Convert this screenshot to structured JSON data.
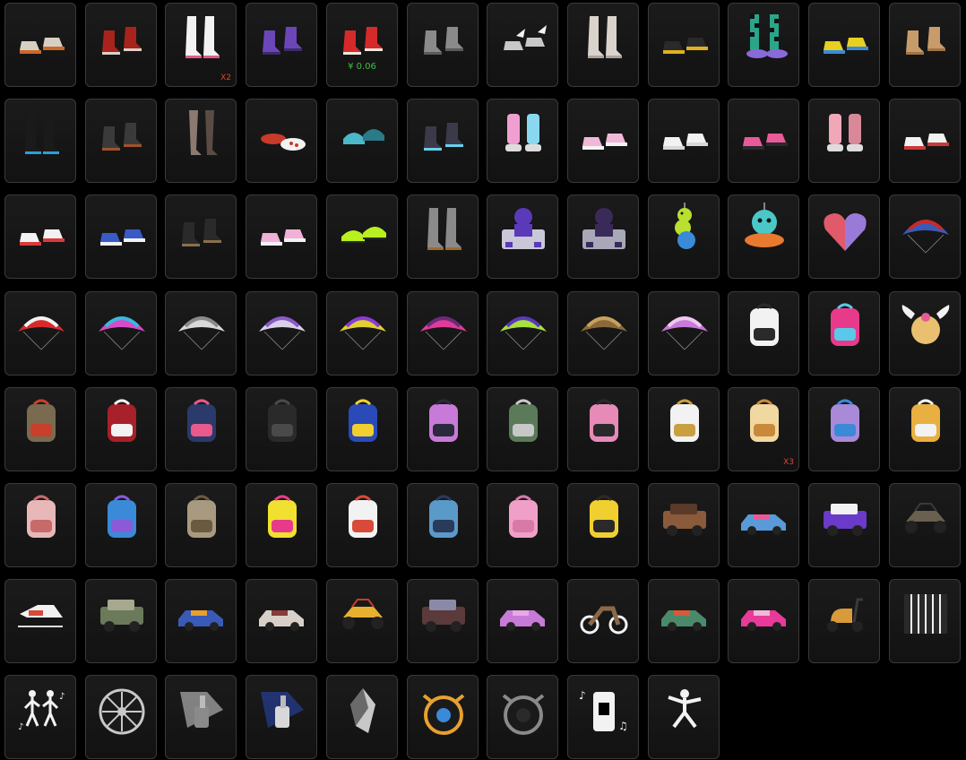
{
  "items": [
    {
      "name": "shoes",
      "icon": "sneakers-icon",
      "colors": [
        "#d8cfc4",
        "#c96a2a"
      ],
      "count": "",
      "price": ""
    },
    {
      "name": "shoes",
      "icon": "boots-icon",
      "colors": [
        "#a8231c",
        "#d9d0c8"
      ],
      "count": "",
      "price": ""
    },
    {
      "name": "shoes",
      "icon": "tall-boots-icon",
      "colors": [
        "#f2f2f2",
        "#e05a8a"
      ],
      "count": "X2",
      "price": ""
    },
    {
      "name": "shoes",
      "icon": "boots-icon",
      "colors": [
        "#6b46b8",
        "#3c2a6a"
      ],
      "count": "",
      "price": ""
    },
    {
      "name": "shoes",
      "icon": "boots-icon",
      "colors": [
        "#d42a2a",
        "#f0e6e0"
      ],
      "count": "",
      "price": "¥ 0.06"
    },
    {
      "name": "shoes",
      "icon": "boots-icon",
      "colors": [
        "#8a8a8a",
        "#5a5a5a"
      ],
      "count": "",
      "price": ""
    },
    {
      "name": "shoes",
      "icon": "winged-shoes-icon",
      "colors": [
        "#c8c8c8",
        "#f2f2f2"
      ],
      "count": "",
      "price": ""
    },
    {
      "name": "shoes",
      "icon": "tall-boots-icon",
      "colors": [
        "#d9d3cc",
        "#a9a39c"
      ],
      "count": "",
      "price": ""
    },
    {
      "name": "shoes",
      "icon": "sneakers-icon",
      "colors": [
        "#2a2a2a",
        "#e0b020"
      ],
      "count": "",
      "price": ""
    },
    {
      "name": "shoes",
      "icon": "checker-socks-icon",
      "colors": [
        "#2aa58a",
        "#8a6ad8"
      ],
      "count": "",
      "price": ""
    },
    {
      "name": "shoes",
      "icon": "sneakers-icon",
      "colors": [
        "#e8d020",
        "#3a8ad8"
      ],
      "count": "",
      "price": ""
    },
    {
      "name": "shoes",
      "icon": "boots-icon",
      "colors": [
        "#c79b6a",
        "#a07445"
      ],
      "count": "",
      "price": ""
    },
    {
      "name": "shoes",
      "icon": "tall-boots-icon",
      "colors": [
        "#1a1a1a",
        "#2aa0d8"
      ],
      "count": "",
      "price": ""
    },
    {
      "name": "shoes",
      "icon": "boots-icon",
      "colors": [
        "#3a3a3a",
        "#a0522d"
      ],
      "count": "",
      "price": ""
    },
    {
      "name": "shoes",
      "icon": "stockings-icon",
      "colors": [
        "#8a7a70",
        "#5a4c44"
      ],
      "count": "",
      "price": ""
    },
    {
      "name": "shoes",
      "icon": "loafers-icon",
      "colors": [
        "#c83a2a",
        "#f2f2f2"
      ],
      "count": "",
      "price": ""
    },
    {
      "name": "shoes",
      "icon": "slippers-icon",
      "colors": [
        "#4ab8c8",
        "#2a7a88"
      ],
      "count": "",
      "price": ""
    },
    {
      "name": "shoes",
      "icon": "boots-icon",
      "colors": [
        "#3a3a4a",
        "#6ad0f0"
      ],
      "count": "",
      "price": ""
    },
    {
      "name": "shoes",
      "icon": "leg-warmers-icon",
      "colors": [
        "#f0a0d0",
        "#8ad8f0"
      ],
      "count": "",
      "price": ""
    },
    {
      "name": "shoes",
      "icon": "sneakers-icon",
      "colors": [
        "#f0b8d8",
        "#f2f2f2"
      ],
      "count": "",
      "price": ""
    },
    {
      "name": "shoes",
      "icon": "sneakers-icon",
      "colors": [
        "#f2f2f2",
        "#d8d8d8"
      ],
      "count": "",
      "price": ""
    },
    {
      "name": "shoes",
      "icon": "sneakers-icon",
      "colors": [
        "#e85a9a",
        "#2a2a2a"
      ],
      "count": "",
      "price": ""
    },
    {
      "name": "shoes",
      "icon": "leg-warmers-icon",
      "colors": [
        "#f0a8b8",
        "#d88898"
      ],
      "count": "",
      "price": ""
    },
    {
      "name": "shoes",
      "icon": "sneakers-icon",
      "colors": [
        "#f2f2f2",
        "#c83a3a"
      ],
      "count": "",
      "price": ""
    },
    {
      "name": "shoes",
      "icon": "sneakers-icon",
      "colors": [
        "#f2f2f2",
        "#d83a3a"
      ],
      "count": "",
      "price": ""
    },
    {
      "name": "shoes",
      "icon": "sneakers-icon",
      "colors": [
        "#3a5ac8",
        "#f2f2f2"
      ],
      "count": "",
      "price": ""
    },
    {
      "name": "shoes",
      "icon": "boots-icon",
      "colors": [
        "#2a2a2a",
        "#8a7050"
      ],
      "count": "",
      "price": ""
    },
    {
      "name": "shoes",
      "icon": "sneakers-icon",
      "colors": [
        "#f0b0d8",
        "#f2f2f2"
      ],
      "count": "",
      "price": ""
    },
    {
      "name": "shoes",
      "icon": "cleats-icon",
      "colors": [
        "#b8f020",
        "#2a2a2a"
      ],
      "count": "",
      "price": ""
    },
    {
      "name": "shoes",
      "icon": "tall-boots-icon",
      "colors": [
        "#8a8a8a",
        "#a06a2a"
      ],
      "count": "",
      "price": ""
    },
    {
      "name": "emblem",
      "icon": "dj-emblem-icon",
      "colors": [
        "#5a3ab8",
        "#c8c8d8"
      ],
      "count": "",
      "price": ""
    },
    {
      "name": "emblem",
      "icon": "dj-emblem-icon",
      "colors": [
        "#3a2a5a",
        "#a8a8b8"
      ],
      "count": "",
      "price": ""
    },
    {
      "name": "pendant",
      "icon": "caterpillar-pendant-icon",
      "colors": [
        "#b8e030",
        "#3a8ad8"
      ],
      "count": "",
      "price": ""
    },
    {
      "name": "pendant",
      "icon": "octopus-pendant-icon",
      "colors": [
        "#4ac8c8",
        "#e87a30"
      ],
      "count": "",
      "price": ""
    },
    {
      "name": "pendant",
      "icon": "heart-pendant-icon",
      "colors": [
        "#e05a6a",
        "#9a7ad8"
      ],
      "count": "",
      "price": ""
    },
    {
      "name": "parachute",
      "icon": "parachute-icon",
      "colors": [
        "#3a5ab8",
        "#c82a2a"
      ],
      "count": "",
      "price": ""
    },
    {
      "name": "parachute",
      "icon": "parachute-icon",
      "colors": [
        "#d82a2a",
        "#f2f2f2"
      ],
      "count": "",
      "price": ""
    },
    {
      "name": "parachute",
      "icon": "parachute-icon",
      "colors": [
        "#d84ac8",
        "#3ab8e0"
      ],
      "count": "",
      "price": ""
    },
    {
      "name": "parachute",
      "icon": "parachute-icon",
      "colors": [
        "#d8d8d8",
        "#8a8a8a"
      ],
      "count": "",
      "price": ""
    },
    {
      "name": "parachute",
      "icon": "parachute-icon",
      "colors": [
        "#d8d0e8",
        "#8a5ac8"
      ],
      "count": "",
      "price": ""
    },
    {
      "name": "parachute",
      "icon": "parachute-icon",
      "colors": [
        "#e0d030",
        "#8a3ad8"
      ],
      "count": "",
      "price": ""
    },
    {
      "name": "parachute",
      "icon": "parachute-icon",
      "colors": [
        "#e03a9a",
        "#6a2a7a"
      ],
      "count": "",
      "price": ""
    },
    {
      "name": "parachute",
      "icon": "parachute-icon",
      "colors": [
        "#a8e040",
        "#5a3ab8"
      ],
      "count": "",
      "price": ""
    },
    {
      "name": "parachute",
      "icon": "parachute-icon",
      "colors": [
        "#8a6a3a",
        "#c8a060"
      ],
      "count": "",
      "price": ""
    },
    {
      "name": "parachute",
      "icon": "parachute-icon",
      "colors": [
        "#c87ad8",
        "#f0c8f0"
      ],
      "count": "",
      "price": ""
    },
    {
      "name": "backpack",
      "icon": "backpack-icon",
      "colors": [
        "#f2f2f2",
        "#2a2a2a"
      ],
      "count": "",
      "price": ""
    },
    {
      "name": "backpack",
      "icon": "backpack-icon",
      "colors": [
        "#e83a8a",
        "#5ac8e8"
      ],
      "count": "",
      "price": ""
    },
    {
      "name": "backpack",
      "icon": "winged-backpack-icon",
      "colors": [
        "#e8c070",
        "#e85a9a"
      ],
      "count": "",
      "price": ""
    },
    {
      "name": "backpack",
      "icon": "backpack-icon",
      "colors": [
        "#7a6a50",
        "#c8402a"
      ],
      "count": "",
      "price": ""
    },
    {
      "name": "backpack",
      "icon": "backpack-icon",
      "colors": [
        "#a8202a",
        "#f2f2f2"
      ],
      "count": "",
      "price": ""
    },
    {
      "name": "backpack",
      "icon": "backpack-icon",
      "colors": [
        "#2a3a6a",
        "#e85a8a"
      ],
      "count": "",
      "price": ""
    },
    {
      "name": "backpack",
      "icon": "backpack-icon",
      "colors": [
        "#2a2a2a",
        "#4a4a4a"
      ],
      "count": "",
      "price": ""
    },
    {
      "name": "backpack",
      "icon": "backpack-icon",
      "colors": [
        "#2a4ab8",
        "#f0d030"
      ],
      "count": "",
      "price": ""
    },
    {
      "name": "backpack",
      "icon": "backpack-icon",
      "colors": [
        "#c87ad8",
        "#2a2a3a"
      ],
      "count": "",
      "price": ""
    },
    {
      "name": "backpack",
      "icon": "backpack-icon",
      "colors": [
        "#5a7a5a",
        "#c8c8c8"
      ],
      "count": "",
      "price": ""
    },
    {
      "name": "backpack",
      "icon": "backpack-icon",
      "colors": [
        "#e88ab8",
        "#2a2a2a"
      ],
      "count": "",
      "price": ""
    },
    {
      "name": "backpack",
      "icon": "backpack-icon",
      "colors": [
        "#f2f2f2",
        "#c8a040"
      ],
      "count": "",
      "price": ""
    },
    {
      "name": "backpack",
      "icon": "backpack-icon",
      "colors": [
        "#f0d8a0",
        "#c88a3a"
      ],
      "count": "X3",
      "price": ""
    },
    {
      "name": "backpack",
      "icon": "backpack-icon",
      "colors": [
        "#a88ad8",
        "#3a8ad8"
      ],
      "count": "",
      "price": ""
    },
    {
      "name": "backpack",
      "icon": "backpack-icon",
      "colors": [
        "#e8b040",
        "#f2f2f2"
      ],
      "count": "",
      "price": ""
    },
    {
      "name": "backpack",
      "icon": "backpack-icon",
      "colors": [
        "#e8b8b8",
        "#c86a6a"
      ],
      "count": "",
      "price": ""
    },
    {
      "name": "backpack",
      "icon": "backpack-icon",
      "colors": [
        "#3a8ad8",
        "#8a5ad8"
      ],
      "count": "",
      "price": ""
    },
    {
      "name": "backpack",
      "icon": "backpack-icon",
      "colors": [
        "#a89a80",
        "#6a5a40"
      ],
      "count": "",
      "price": ""
    },
    {
      "name": "backpack",
      "icon": "backpack-icon",
      "colors": [
        "#f0e030",
        "#e83a8a"
      ],
      "count": "",
      "price": ""
    },
    {
      "name": "backpack",
      "icon": "backpack-icon",
      "colors": [
        "#f2f2f2",
        "#d84a3a"
      ],
      "count": "",
      "price": ""
    },
    {
      "name": "backpack",
      "icon": "backpack-icon",
      "colors": [
        "#5a9ac8",
        "#2a3a5a"
      ],
      "count": "",
      "price": ""
    },
    {
      "name": "backpack",
      "icon": "backpack-icon",
      "colors": [
        "#f0a0c8",
        "#d87aa8"
      ],
      "count": "",
      "price": ""
    },
    {
      "name": "backpack",
      "icon": "backpack-icon",
      "colors": [
        "#f0d030",
        "#2a2a2a"
      ],
      "count": "",
      "price": ""
    },
    {
      "name": "vehicle",
      "icon": "suv-icon",
      "colors": [
        "#8a5a3a",
        "#5a3a2a"
      ],
      "count": "",
      "price": ""
    },
    {
      "name": "vehicle",
      "icon": "sedan-icon",
      "colors": [
        "#5a9ad8",
        "#e85a9a"
      ],
      "count": "",
      "price": ""
    },
    {
      "name": "vehicle",
      "icon": "suv-icon",
      "colors": [
        "#6a3ac8",
        "#f2f2f2"
      ],
      "count": "",
      "price": ""
    },
    {
      "name": "vehicle",
      "icon": "buggy-icon",
      "colors": [
        "#6a6050",
        "#3a3a3a"
      ],
      "count": "",
      "price": ""
    },
    {
      "name": "vehicle",
      "icon": "snowmobile-icon",
      "colors": [
        "#f2f2f2",
        "#d84a3a"
      ],
      "count": "",
      "price": ""
    },
    {
      "name": "vehicle",
      "icon": "suv-icon",
      "colors": [
        "#6a7a5a",
        "#a8a890"
      ],
      "count": "",
      "price": ""
    },
    {
      "name": "vehicle",
      "icon": "sedan-icon",
      "colors": [
        "#3a5ab8",
        "#e8a030"
      ],
      "count": "",
      "price": ""
    },
    {
      "name": "vehicle",
      "icon": "sedan-icon",
      "colors": [
        "#d8d0c8",
        "#8a3a3a"
      ],
      "count": "",
      "price": ""
    },
    {
      "name": "vehicle",
      "icon": "buggy-icon",
      "colors": [
        "#e8b030",
        "#c83a2a"
      ],
      "count": "",
      "price": ""
    },
    {
      "name": "vehicle",
      "icon": "suv-icon",
      "colors": [
        "#5a3a3a",
        "#8a8aa8"
      ],
      "count": "",
      "price": ""
    },
    {
      "name": "vehicle",
      "icon": "sedan-icon",
      "colors": [
        "#c87ad8",
        "#e8a8e8"
      ],
      "count": "",
      "price": ""
    },
    {
      "name": "vehicle",
      "icon": "motorbike-icon",
      "colors": [
        "#8a6a4a",
        "#f2f2f2"
      ],
      "count": "",
      "price": ""
    },
    {
      "name": "vehicle",
      "icon": "sedan-icon",
      "colors": [
        "#4a8a6a",
        "#d85a3a"
      ],
      "count": "",
      "price": ""
    },
    {
      "name": "vehicle",
      "icon": "sedan-icon",
      "colors": [
        "#e83a9a",
        "#f0b8d8"
      ],
      "count": "",
      "price": ""
    },
    {
      "name": "vehicle",
      "icon": "scooter-icon",
      "colors": [
        "#d89a3a",
        "#3a3a3a"
      ],
      "count": "",
      "price": ""
    },
    {
      "name": "emote",
      "icon": "jail-emote-icon",
      "colors": [
        "#f2f2f2",
        "#2a2a2a"
      ],
      "count": "",
      "price": ""
    },
    {
      "name": "emote",
      "icon": "dance-duo-emote-icon",
      "colors": [
        "#f2f2f2",
        "#000000"
      ],
      "count": "",
      "price": ""
    },
    {
      "name": "wheel",
      "icon": "wheel-rim-icon",
      "colors": [
        "#c8c8c8",
        "#3a3a3a"
      ],
      "count": "",
      "price": ""
    },
    {
      "name": "spray",
      "icon": "spray-gun-icon",
      "colors": [
        "#d8d8d8",
        "#8a8a8a"
      ],
      "count": "",
      "price": ""
    },
    {
      "name": "spray",
      "icon": "spray-gun-icon",
      "colors": [
        "#2a4ab8",
        "#d8d8d8"
      ],
      "count": "",
      "price": ""
    },
    {
      "name": "material",
      "icon": "crystal-icon",
      "colors": [
        "#c8c8c8",
        "#6a6a6a"
      ],
      "count": "",
      "price": ""
    },
    {
      "name": "wheel",
      "icon": "racing-wheel-badge-icon",
      "colors": [
        "#e8a030",
        "#3a8ad8"
      ],
      "count": "",
      "price": ""
    },
    {
      "name": "wheel",
      "icon": "racing-wheel-badge-icon",
      "colors": [
        "#8a8a8a",
        "#2a2a2a"
      ],
      "count": "",
      "price": ""
    },
    {
      "name": "emote",
      "icon": "music-emote-icon",
      "colors": [
        "#f2f2f2",
        "#000000"
      ],
      "count": "",
      "price": ""
    },
    {
      "name": "emote",
      "icon": "fencing-emote-icon",
      "colors": [
        "#f2f2f2",
        "#000000"
      ],
      "count": "",
      "price": ""
    }
  ]
}
